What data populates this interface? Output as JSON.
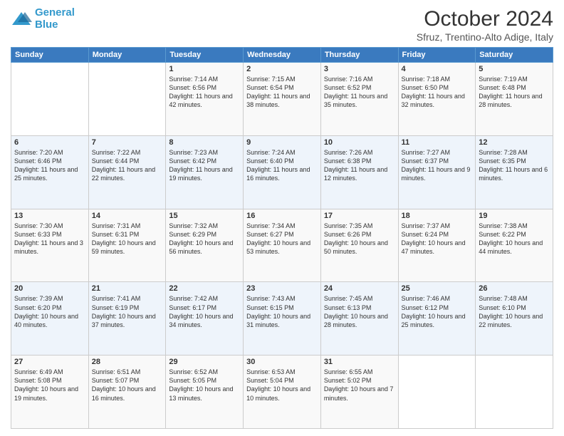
{
  "header": {
    "logo_line1": "General",
    "logo_line2": "Blue",
    "month_title": "October 2024",
    "location": "Sfruz, Trentino-Alto Adige, Italy"
  },
  "days_of_week": [
    "Sunday",
    "Monday",
    "Tuesday",
    "Wednesday",
    "Thursday",
    "Friday",
    "Saturday"
  ],
  "weeks": [
    [
      {
        "day": "",
        "content": ""
      },
      {
        "day": "",
        "content": ""
      },
      {
        "day": "1",
        "content": "Sunrise: 7:14 AM\nSunset: 6:56 PM\nDaylight: 11 hours and 42 minutes."
      },
      {
        "day": "2",
        "content": "Sunrise: 7:15 AM\nSunset: 6:54 PM\nDaylight: 11 hours and 38 minutes."
      },
      {
        "day": "3",
        "content": "Sunrise: 7:16 AM\nSunset: 6:52 PM\nDaylight: 11 hours and 35 minutes."
      },
      {
        "day": "4",
        "content": "Sunrise: 7:18 AM\nSunset: 6:50 PM\nDaylight: 11 hours and 32 minutes."
      },
      {
        "day": "5",
        "content": "Sunrise: 7:19 AM\nSunset: 6:48 PM\nDaylight: 11 hours and 28 minutes."
      }
    ],
    [
      {
        "day": "6",
        "content": "Sunrise: 7:20 AM\nSunset: 6:46 PM\nDaylight: 11 hours and 25 minutes."
      },
      {
        "day": "7",
        "content": "Sunrise: 7:22 AM\nSunset: 6:44 PM\nDaylight: 11 hours and 22 minutes."
      },
      {
        "day": "8",
        "content": "Sunrise: 7:23 AM\nSunset: 6:42 PM\nDaylight: 11 hours and 19 minutes."
      },
      {
        "day": "9",
        "content": "Sunrise: 7:24 AM\nSunset: 6:40 PM\nDaylight: 11 hours and 16 minutes."
      },
      {
        "day": "10",
        "content": "Sunrise: 7:26 AM\nSunset: 6:38 PM\nDaylight: 11 hours and 12 minutes."
      },
      {
        "day": "11",
        "content": "Sunrise: 7:27 AM\nSunset: 6:37 PM\nDaylight: 11 hours and 9 minutes."
      },
      {
        "day": "12",
        "content": "Sunrise: 7:28 AM\nSunset: 6:35 PM\nDaylight: 11 hours and 6 minutes."
      }
    ],
    [
      {
        "day": "13",
        "content": "Sunrise: 7:30 AM\nSunset: 6:33 PM\nDaylight: 11 hours and 3 minutes."
      },
      {
        "day": "14",
        "content": "Sunrise: 7:31 AM\nSunset: 6:31 PM\nDaylight: 10 hours and 59 minutes."
      },
      {
        "day": "15",
        "content": "Sunrise: 7:32 AM\nSunset: 6:29 PM\nDaylight: 10 hours and 56 minutes."
      },
      {
        "day": "16",
        "content": "Sunrise: 7:34 AM\nSunset: 6:27 PM\nDaylight: 10 hours and 53 minutes."
      },
      {
        "day": "17",
        "content": "Sunrise: 7:35 AM\nSunset: 6:26 PM\nDaylight: 10 hours and 50 minutes."
      },
      {
        "day": "18",
        "content": "Sunrise: 7:37 AM\nSunset: 6:24 PM\nDaylight: 10 hours and 47 minutes."
      },
      {
        "day": "19",
        "content": "Sunrise: 7:38 AM\nSunset: 6:22 PM\nDaylight: 10 hours and 44 minutes."
      }
    ],
    [
      {
        "day": "20",
        "content": "Sunrise: 7:39 AM\nSunset: 6:20 PM\nDaylight: 10 hours and 40 minutes."
      },
      {
        "day": "21",
        "content": "Sunrise: 7:41 AM\nSunset: 6:19 PM\nDaylight: 10 hours and 37 minutes."
      },
      {
        "day": "22",
        "content": "Sunrise: 7:42 AM\nSunset: 6:17 PM\nDaylight: 10 hours and 34 minutes."
      },
      {
        "day": "23",
        "content": "Sunrise: 7:43 AM\nSunset: 6:15 PM\nDaylight: 10 hours and 31 minutes."
      },
      {
        "day": "24",
        "content": "Sunrise: 7:45 AM\nSunset: 6:13 PM\nDaylight: 10 hours and 28 minutes."
      },
      {
        "day": "25",
        "content": "Sunrise: 7:46 AM\nSunset: 6:12 PM\nDaylight: 10 hours and 25 minutes."
      },
      {
        "day": "26",
        "content": "Sunrise: 7:48 AM\nSunset: 6:10 PM\nDaylight: 10 hours and 22 minutes."
      }
    ],
    [
      {
        "day": "27",
        "content": "Sunrise: 6:49 AM\nSunset: 5:08 PM\nDaylight: 10 hours and 19 minutes."
      },
      {
        "day": "28",
        "content": "Sunrise: 6:51 AM\nSunset: 5:07 PM\nDaylight: 10 hours and 16 minutes."
      },
      {
        "day": "29",
        "content": "Sunrise: 6:52 AM\nSunset: 5:05 PM\nDaylight: 10 hours and 13 minutes."
      },
      {
        "day": "30",
        "content": "Sunrise: 6:53 AM\nSunset: 5:04 PM\nDaylight: 10 hours and 10 minutes."
      },
      {
        "day": "31",
        "content": "Sunrise: 6:55 AM\nSunset: 5:02 PM\nDaylight: 10 hours and 7 minutes."
      },
      {
        "day": "",
        "content": ""
      },
      {
        "day": "",
        "content": ""
      }
    ]
  ]
}
